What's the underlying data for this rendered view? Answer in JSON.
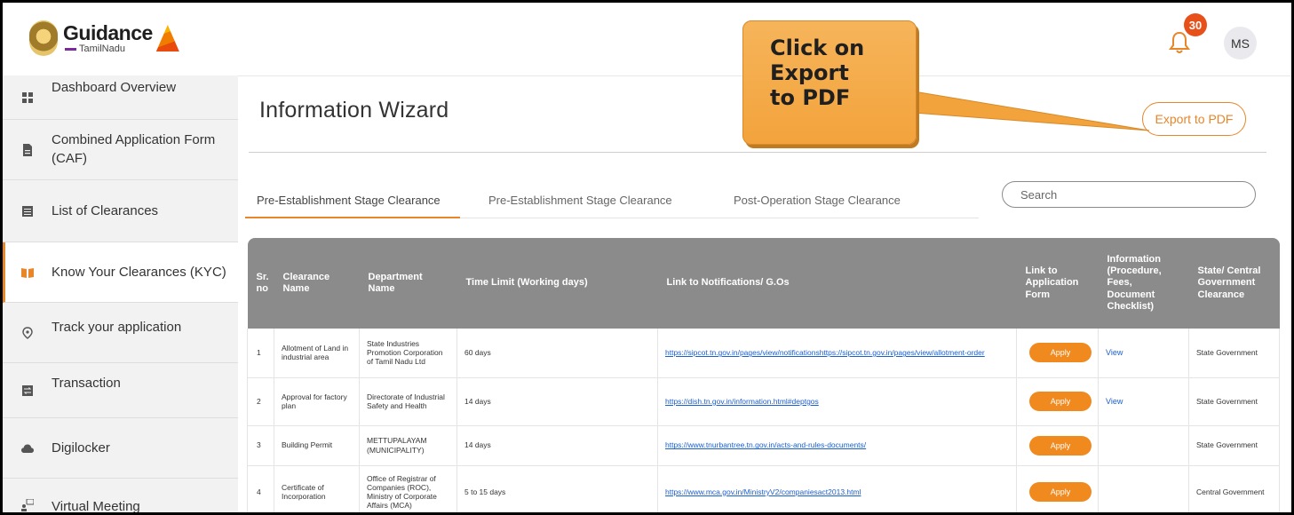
{
  "brand": {
    "name": "Guidance",
    "sub": "TamilNadu"
  },
  "header": {
    "notification_count": "30",
    "avatar_initials": "MS"
  },
  "sidebar": {
    "items": [
      {
        "label": "Dashboard Overview",
        "icon": "grid-icon"
      },
      {
        "label": "Combined Application Form (CAF)",
        "icon": "document-icon"
      },
      {
        "label": "List of Clearances",
        "icon": "list-icon"
      },
      {
        "label": "Know Your Clearances (KYC)",
        "icon": "book-icon",
        "active": true
      },
      {
        "label": "Track your application",
        "icon": "location-pin-icon"
      },
      {
        "label": "Transaction",
        "icon": "transaction-icon"
      },
      {
        "label": "Digilocker",
        "icon": "cloud-icon"
      },
      {
        "label": "Virtual Meeting",
        "icon": "meeting-icon"
      }
    ]
  },
  "main": {
    "title": "Information Wizard",
    "export_label": "Export to PDF",
    "tabs": [
      {
        "label": "Pre-Establishment Stage Clearance",
        "active": true
      },
      {
        "label": "Pre-Establishment Stage Clearance"
      },
      {
        "label": "Post-Operation Stage Clearance"
      }
    ],
    "search_placeholder": "Search",
    "table": {
      "headers": {
        "sr": "Sr. no",
        "name": "Clearance Name",
        "dept": "Department Name",
        "time": "Time Limit (Working days)",
        "link": "Link to Notifications/ G.Os",
        "apply": "Link to Application Form",
        "info": "Information (Procedure, Fees, Document Checklist)",
        "govt": "State/ Central Government Clearance"
      },
      "rows": [
        {
          "sr": "1",
          "name": "Allotment of Land in industrial area",
          "dept": "State Industries Promotion Corporation of Tamil Nadu Ltd",
          "time": "60 days",
          "link": "https://sipcot.tn.gov.in/pages/view/notificationshttps://sipcot.tn.gov.in/pages/view/allotment-order",
          "apply": "Apply",
          "info": "View",
          "govt": "State Government"
        },
        {
          "sr": "2",
          "name": "Approval for factory plan",
          "dept": "Directorate of Industrial Safety and Health",
          "time": "14 days",
          "link": "https://dish.tn.gov.in/information.html#deptgos",
          "apply": "Apply",
          "info": "View",
          "govt": "State Government"
        },
        {
          "sr": "3",
          "name": "Building Permit",
          "dept": "METTUPALAYAM (MUNICIPALITY)",
          "time": "14 days",
          "link": "https://www.tnurbantree.tn.gov.in/acts-and-rules-documents/",
          "apply": "Apply",
          "info": "",
          "govt": "State Government"
        },
        {
          "sr": "4",
          "name": "Certificate of Incorporation",
          "dept": "Office of Registrar of Companies (ROC), Ministry of Corporate Affairs (MCA)",
          "time": "5 to 15 days",
          "link": "https://www.mca.gov.in/MinistryV2/companiesact2013.html",
          "apply": "Apply",
          "info": "",
          "govt": "Central Government"
        }
      ]
    }
  },
  "callout": {
    "text": "Click on\nExport\nto PDF"
  },
  "colors": {
    "accent": "#e8862a",
    "apply": "#f08a1e",
    "badge": "#e8501a",
    "header_gray": "#8b8b8b",
    "link": "#1a5fd0",
    "callout": "#f3a33c"
  }
}
